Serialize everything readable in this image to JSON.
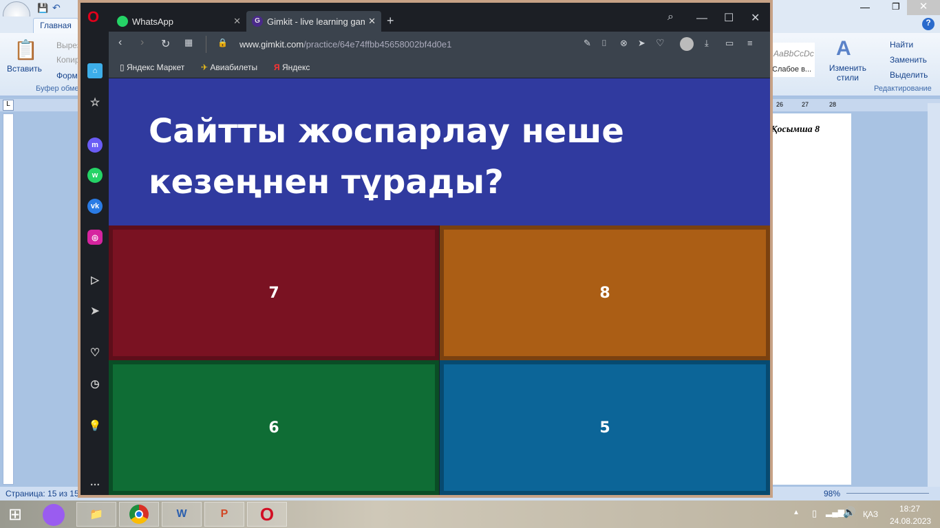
{
  "word": {
    "tab_home": "Главная",
    "paste": "Вставить",
    "cut": "Вырез",
    "copy": "Копир",
    "format": "Форма",
    "clipboard_group": "Буфер обме",
    "style_preview": "AaBbCcDc",
    "style_name": "Слабое в...",
    "change_styles": "Изменить стили",
    "find": "Найти",
    "replace": "Заменить",
    "select": "Выделить",
    "editing_group": "Редактирование",
    "ruler_marks": [
      "26",
      "27",
      "28"
    ],
    "doc_text": "Қосымша 8",
    "page_status": "Страница: 15 из 15",
    "zoom": "98%"
  },
  "browser": {
    "tabs": [
      {
        "label": "WhatsApp",
        "active": false
      },
      {
        "label": "Gimkit - live learning game",
        "active": true
      }
    ],
    "url_domain": "www.gimkit.com",
    "url_path": "/practice/64e74ffbb45658002bf4d0e1",
    "bookmarks": [
      "Яндекс Маркет",
      "Авиабилеты",
      "Яндекс"
    ]
  },
  "quiz": {
    "question": "Сайтты жоспарлау неше кезеңнен тұрады?",
    "answers": [
      {
        "label": "7",
        "color": "#7a1222"
      },
      {
        "label": "8",
        "color": "#ab5e15"
      },
      {
        "label": "6",
        "color": "#0f6d35"
      },
      {
        "label": "5",
        "color": "#0c6598"
      }
    ]
  },
  "taskbar": {
    "language": "ҚАЗ",
    "time": "18:27",
    "date": "24.08.2023"
  }
}
